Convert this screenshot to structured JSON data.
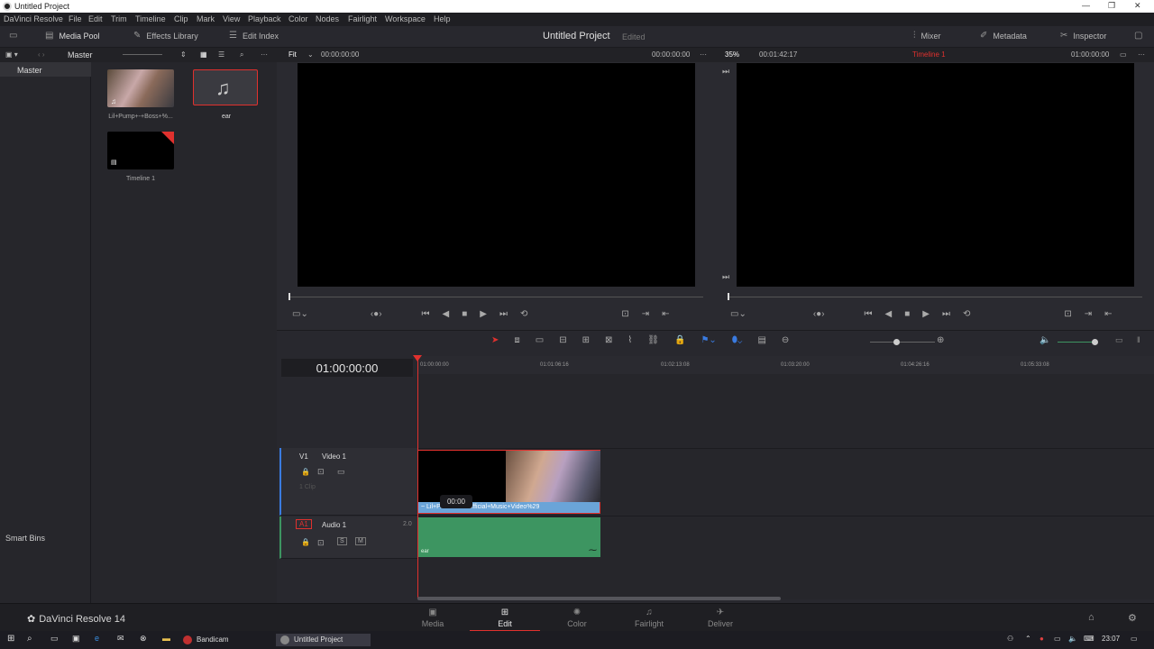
{
  "window": {
    "title": "Untitled Project"
  },
  "menu": [
    "DaVinci Resolve",
    "File",
    "Edit",
    "Trim",
    "Timeline",
    "Clip",
    "Mark",
    "View",
    "Playback",
    "Color",
    "Nodes",
    "Fairlight",
    "Workspace",
    "Help"
  ],
  "toolbar": {
    "media_pool": "Media Pool",
    "effects_library": "Effects Library",
    "edit_index": "Edit Index",
    "project_title": "Untitled Project",
    "project_status": "Edited",
    "mixer": "Mixer",
    "metadata": "Metadata",
    "inspector": "Inspector"
  },
  "subbar": {
    "bin_name": "Master",
    "source_zoom": "Fit",
    "source_tc_left": "00:00:00:00",
    "source_tc_right": "00:00:00:00",
    "timeline_zoom": "35%",
    "timeline_duration": "00:01:42:17",
    "timeline_name": "Timeline 1",
    "timeline_tc": "01:00:00:00"
  },
  "bins": {
    "master": "Master",
    "smart_bins": "Smart Bins"
  },
  "pool_items": [
    {
      "label": "Lil+Pump+-+Boss+%...",
      "kind": "video"
    },
    {
      "label": "ear",
      "kind": "audio"
    },
    {
      "label": "Timeline 1",
      "kind": "timeline"
    }
  ],
  "timeline": {
    "timecode": "01:00:00:00",
    "ruler": [
      "01:00:00:00",
      "01:01:06:16",
      "01:02:13:08",
      "01:03:20:00",
      "01:04:26:16",
      "01:05:33:08"
    ],
    "video_track": {
      "id": "V1",
      "name": "Video 1",
      "clips": "1 Clip"
    },
    "audio_track": {
      "id": "A1",
      "name": "Audio 1",
      "channels": "2.0"
    },
    "video_clip_label": "~ Lil+P...ss+%28Official+Music+Video%29",
    "audio_clip_label": "ear",
    "tooltip": "00:00"
  },
  "pages": [
    "Media",
    "Edit",
    "Color",
    "Fairlight",
    "Deliver"
  ],
  "active_page": "Edit",
  "brand": "DaVinci Resolve 14",
  "taskbar": {
    "app1": "Bandicam",
    "app2": "Untitled Project",
    "clock": "23:07"
  },
  "colors": {
    "accent": "#e0312e",
    "video_clip": "#6aa4d8",
    "audio_clip": "#3d9561"
  }
}
